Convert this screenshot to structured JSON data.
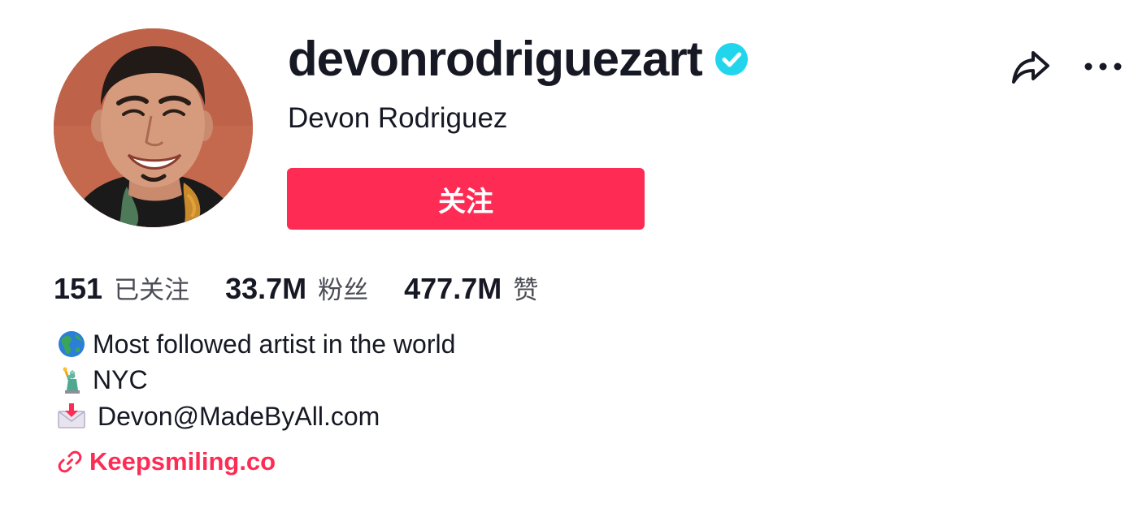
{
  "profile": {
    "username": "devonrodriguezart",
    "display_name": "Devon Rodriguez",
    "verified": true,
    "follow_label": "关注"
  },
  "stats": [
    {
      "count": "151",
      "label": "已关注"
    },
    {
      "count": "33.7M",
      "label": "粉丝"
    },
    {
      "count": "477.7M",
      "label": "赞"
    }
  ],
  "bio": {
    "line1": "Most followed artist in the world",
    "line2": "NYC",
    "line3": "Devon@MadeByAll.com",
    "line1_icon": "globe-americas-icon",
    "line2_icon": "statue-of-liberty-icon",
    "line3_icon": "envelope-with-arrow-icon"
  },
  "link": {
    "text": "Keepsmiling.co",
    "icon": "link-icon"
  },
  "actions": {
    "share_icon": "share-icon",
    "more_icon": "more-icon"
  },
  "colors": {
    "accent": "#fe2c55",
    "verified": "#20d5ec",
    "text": "#161823",
    "muted": "#4b4c55"
  }
}
